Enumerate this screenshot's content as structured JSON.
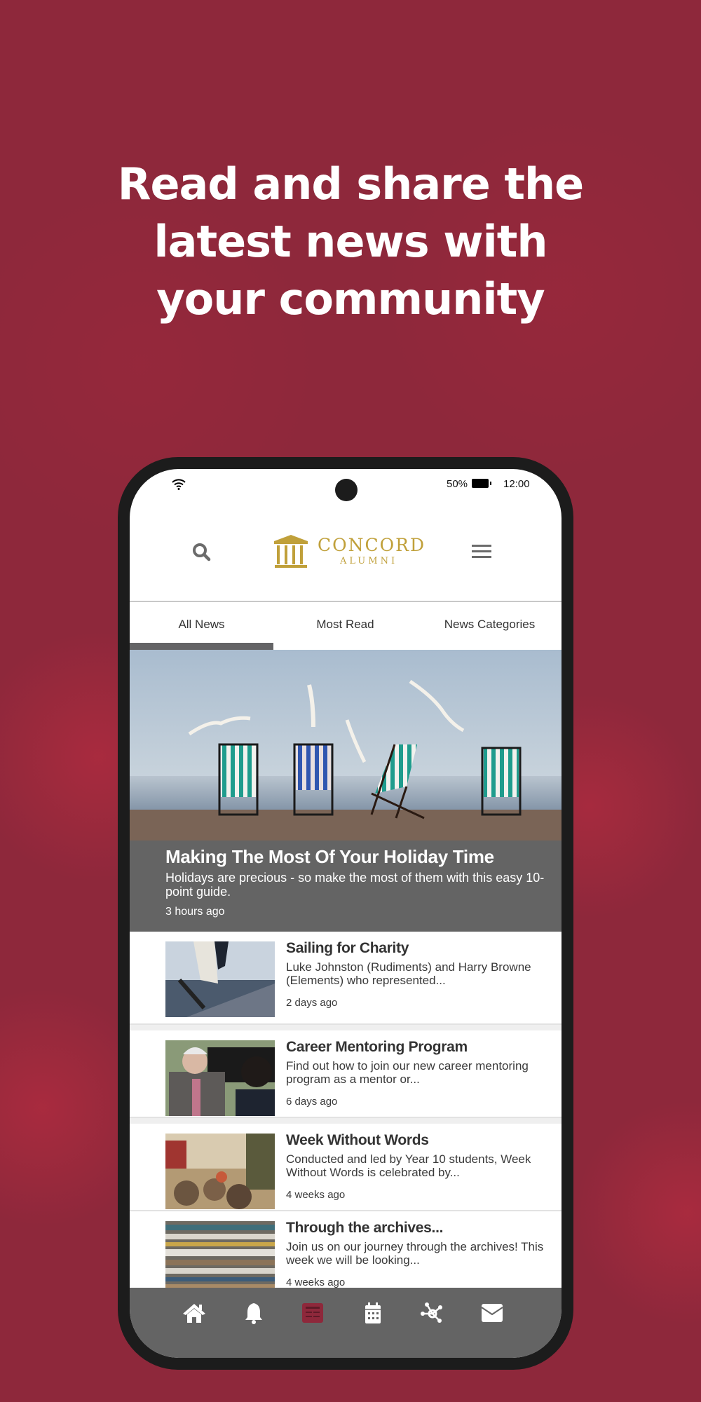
{
  "headline": {
    "lines": [
      "Read and share the",
      "latest news with",
      "your community"
    ]
  },
  "status_bar": {
    "battery_percent": "50%",
    "time": "12:00",
    "icons": [
      "wifi-icon",
      "battery-icon"
    ]
  },
  "header": {
    "logo_name": "CONCORD",
    "logo_sub": "ALUMNI",
    "search_icon": "search-icon",
    "menu_icon": "hamburger-menu-icon"
  },
  "tabs": [
    {
      "label": "All News",
      "active": true
    },
    {
      "label": "Most Read",
      "active": false
    },
    {
      "label": "News Categories",
      "active": false
    }
  ],
  "featured": {
    "title": "Making The Most Of Your Holiday Time",
    "description": "Holidays are precious - so make the most of them with this easy 10-point guide.",
    "time": "3 hours ago",
    "image": "beach-deckchairs-seagulls"
  },
  "news": [
    {
      "title": "Sailing for Charity",
      "description": "Luke Johnston (Rudiments) and Harry Browne (Elements) who represented...",
      "time": "2 days ago",
      "image": "sailboat"
    },
    {
      "title": "Career Mentoring Program",
      "description": "Find out how to join our new career mentoring program as a mentor or...",
      "time": "6 days ago",
      "image": "mentoring-conversation"
    },
    {
      "title": "Week Without Words",
      "description": "Conducted and led by Year 10 students, Week Without Words is celebrated by...",
      "time": "4 weeks ago",
      "image": "crowded-street"
    },
    {
      "title": "Through the archives...",
      "description": "Join us on our journey through the archives! This week we will be looking...",
      "time": "4 weeks ago",
      "image": "stack-of-books"
    }
  ],
  "bottom_nav": [
    {
      "icon": "home-icon",
      "active": false
    },
    {
      "icon": "bell-icon",
      "active": false
    },
    {
      "icon": "news-icon",
      "active": true
    },
    {
      "icon": "calendar-icon",
      "active": false
    },
    {
      "icon": "network-icon",
      "active": false
    },
    {
      "icon": "mail-icon",
      "active": false
    }
  ],
  "colors": {
    "background": "#8e283b",
    "brand_gold": "#c0a03a",
    "active_nav": "#8e283b",
    "nav_bar": "#646464"
  }
}
